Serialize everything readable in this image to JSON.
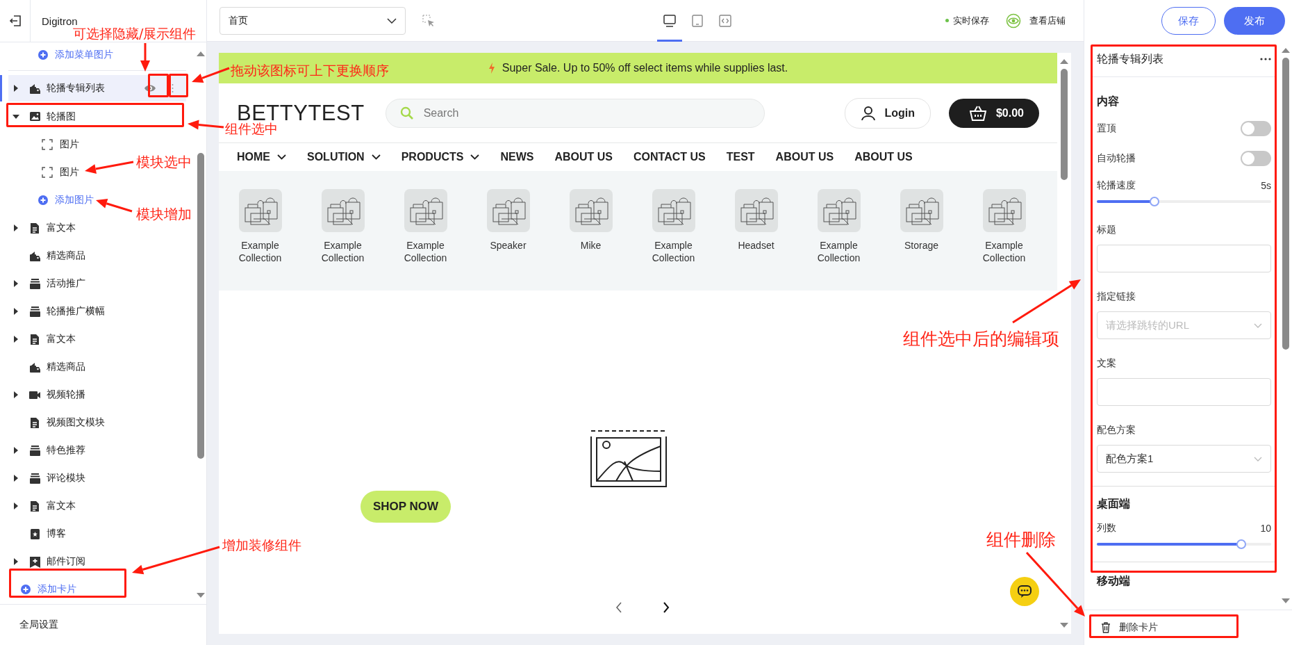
{
  "sidebar": {
    "app_name": "Digitron",
    "add_menu_image": "添加菜单图片",
    "items": [
      {
        "label": "轮播专辑列表",
        "kind": "product",
        "collapsible": true,
        "expanded": false,
        "selected": true
      },
      {
        "label": "轮播图",
        "kind": "banner",
        "collapsible": true,
        "expanded": true,
        "selected": false,
        "children": [
          {
            "label": "图片",
            "kind": "slot",
            "selected": false
          },
          {
            "label": "图片",
            "kind": "slot",
            "selected": false
          },
          {
            "label": "添加图片",
            "kind": "add"
          }
        ]
      },
      {
        "label": "富文本",
        "kind": "richtext",
        "collapsible": true,
        "expanded": false,
        "selected": false
      },
      {
        "label": "精选商品",
        "kind": "product",
        "collapsible": false,
        "selected": false
      },
      {
        "label": "活动推广",
        "kind": "promo",
        "collapsible": true,
        "expanded": false,
        "selected": false
      },
      {
        "label": "轮播推广横幅",
        "kind": "promo",
        "collapsible": true,
        "expanded": false,
        "selected": false
      },
      {
        "label": "富文本",
        "kind": "richtext",
        "collapsible": true,
        "expanded": false,
        "selected": false
      },
      {
        "label": "精选商品",
        "kind": "product",
        "collapsible": false,
        "selected": false
      },
      {
        "label": "视频轮播",
        "kind": "video",
        "collapsible": true,
        "expanded": false,
        "selected": false
      },
      {
        "label": "视频图文模块",
        "kind": "richtext",
        "collapsible": false,
        "selected": false
      },
      {
        "label": "特色推荐",
        "kind": "promo",
        "collapsible": true,
        "expanded": false,
        "selected": false
      },
      {
        "label": "评论模块",
        "kind": "promo",
        "collapsible": true,
        "expanded": false,
        "selected": false
      },
      {
        "label": "富文本",
        "kind": "richtext",
        "collapsible": true,
        "expanded": false,
        "selected": false
      },
      {
        "label": "博客",
        "kind": "blog",
        "collapsible": false,
        "selected": false
      },
      {
        "label": "邮件订阅",
        "kind": "subscribe",
        "collapsible": true,
        "expanded": false,
        "selected": false
      }
    ],
    "add_card": "添加卡片",
    "global_settings": "全局设置"
  },
  "toolbar": {
    "page_select": {
      "value": "首页"
    },
    "devices": [
      {
        "kind": "desktop",
        "selected": true
      },
      {
        "kind": "tablet",
        "selected": false
      },
      {
        "kind": "embed",
        "selected": false
      }
    ],
    "autosave": "实时保存",
    "view_store": "查看店铺"
  },
  "actions": {
    "save": "保存",
    "publish": "发布"
  },
  "preview": {
    "announcement": "Super Sale. Up to 50% off select items while supplies last.",
    "logo": "BETTYTEST",
    "search": {
      "placeholder": "Search"
    },
    "login": "Login",
    "cart": "$0.00",
    "nav": [
      {
        "label": "HOME",
        "dropdown": true
      },
      {
        "label": "SOLUTION",
        "dropdown": true
      },
      {
        "label": "PRODUCTS",
        "dropdown": true
      },
      {
        "label": "NEWS",
        "dropdown": false
      },
      {
        "label": "ABOUT US",
        "dropdown": false
      },
      {
        "label": "CONTACT US",
        "dropdown": false
      },
      {
        "label": "TEST",
        "dropdown": false
      },
      {
        "label": "ABOUT US",
        "dropdown": false
      },
      {
        "label": "ABOUT US",
        "dropdown": false
      }
    ],
    "collections": [
      {
        "label": "Example Collection"
      },
      {
        "label": "Example Collection"
      },
      {
        "label": "Example Collection"
      },
      {
        "label": "Speaker"
      },
      {
        "label": "Mike"
      },
      {
        "label": "Example Collection"
      },
      {
        "label": "Headset"
      },
      {
        "label": "Example Collection"
      },
      {
        "label": "Storage"
      },
      {
        "label": "Example Collection"
      }
    ],
    "banner": {
      "button": "SHOP NOW"
    }
  },
  "settings": {
    "title": "轮播专辑列表",
    "sections": [
      {
        "heading": "内容",
        "fields": [
          {
            "kind": "toggle",
            "label": "置顶",
            "on": false
          },
          {
            "kind": "toggle",
            "label": "自动轮播",
            "on": false
          },
          {
            "kind": "slider",
            "label": "轮播速度",
            "reading": "5s",
            "level": 0.33
          },
          {
            "kind": "input",
            "label": "标题"
          },
          {
            "kind": "select",
            "label": "指定链接",
            "placeholder": "请选择跳转的URL"
          },
          {
            "kind": "input",
            "label": "文案"
          },
          {
            "kind": "select",
            "label": "配色方案",
            "value": "配色方案1"
          }
        ]
      },
      {
        "heading": "桌面端",
        "fields": [
          {
            "kind": "slider",
            "label": "列数",
            "reading": "10",
            "level": 0.83
          }
        ]
      },
      {
        "heading": "移动端"
      }
    ],
    "delete": "删除卡片"
  },
  "annotations": [
    {
      "text": "可选择隐藏/展示组件"
    },
    {
      "text": "拖动该图标可上下更换顺序"
    },
    {
      "text": "组件选中"
    },
    {
      "text": "模块选中"
    },
    {
      "text": "模块增加"
    },
    {
      "text": "增加装修组件"
    },
    {
      "text": "组件选中后的编辑项"
    },
    {
      "text": "组件删除"
    }
  ]
}
